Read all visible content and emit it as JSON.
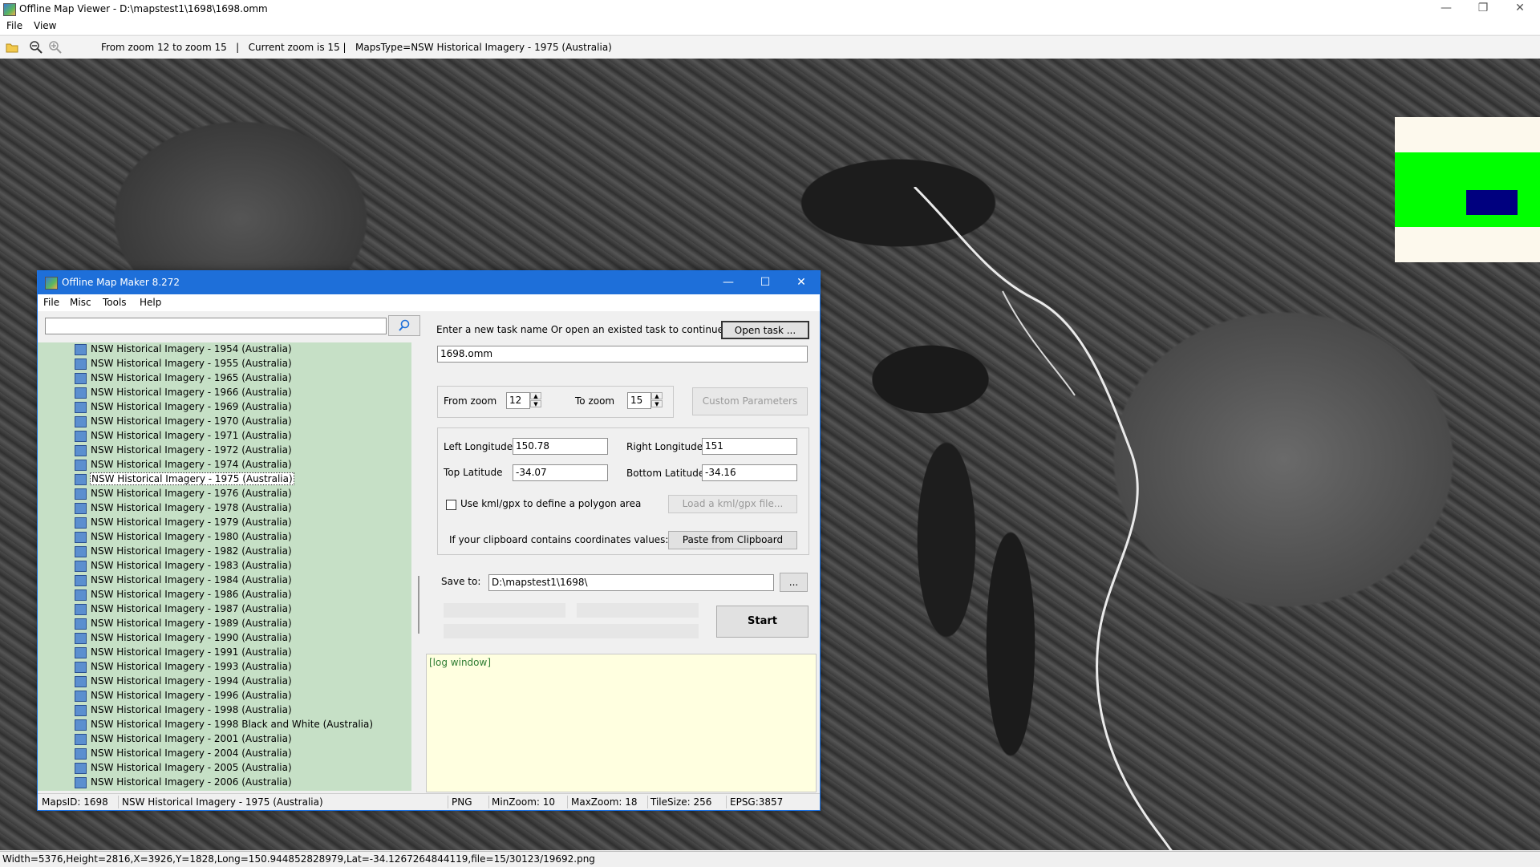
{
  "viewer": {
    "title": "Offline Map Viewer - D:\\mapstest1\\1698\\1698.omm",
    "window_controls": {
      "minimize": "—",
      "maximize": "❐",
      "close": "✕"
    },
    "menu": [
      "File",
      "View"
    ],
    "toolbar_status": "From zoom 12 to zoom 15   |   Current zoom is 15 |   MapsType=NSW Historical Imagery - 1975 (Australia)",
    "statusbar": "Width=5376,Height=2816,X=3926,Y=1828,Long=150.944852828979,Lat=-34.1267264844119,file=15/30123/19692.png",
    "minimap_colors": {
      "background": "#fdf9ed",
      "coverage": "#00ff00",
      "viewport": "#00007f"
    }
  },
  "dialog": {
    "title": "Offline Map Maker 8.272",
    "window_controls": {
      "minimize": "—",
      "maximize": "☐",
      "close": "✕"
    },
    "menu": [
      "File",
      "Misc",
      "Tools",
      "Help"
    ],
    "search": {
      "value": "",
      "icon": "search-icon"
    },
    "tree": {
      "items": [
        "NSW Historical Imagery - 1954 (Australia)",
        "NSW Historical Imagery - 1955 (Australia)",
        "NSW Historical Imagery - 1965 (Australia)",
        "NSW Historical Imagery - 1966 (Australia)",
        "NSW Historical Imagery - 1969 (Australia)",
        "NSW Historical Imagery - 1970 (Australia)",
        "NSW Historical Imagery - 1971 (Australia)",
        "NSW Historical Imagery - 1972 (Australia)",
        "NSW Historical Imagery - 1974 (Australia)",
        "NSW Historical Imagery - 1975 (Australia)",
        "NSW Historical Imagery - 1976 (Australia)",
        "NSW Historical Imagery - 1978 (Australia)",
        "NSW Historical Imagery - 1979 (Australia)",
        "NSW Historical Imagery - 1980 (Australia)",
        "NSW Historical Imagery - 1982 (Australia)",
        "NSW Historical Imagery - 1983 (Australia)",
        "NSW Historical Imagery - 1984 (Australia)",
        "NSW Historical Imagery - 1986 (Australia)",
        "NSW Historical Imagery - 1987 (Australia)",
        "NSW Historical Imagery - 1989 (Australia)",
        "NSW Historical Imagery - 1990 (Australia)",
        "NSW Historical Imagery - 1991 (Australia)",
        "NSW Historical Imagery - 1993 (Australia)",
        "NSW Historical Imagery - 1994 (Australia)",
        "NSW Historical Imagery - 1996 (Australia)",
        "NSW Historical Imagery - 1998 (Australia)",
        "NSW Historical Imagery - 1998 Black and White (Australia)",
        "NSW Historical Imagery - 2001 (Australia)",
        "NSW Historical Imagery - 2004 (Australia)",
        "NSW Historical Imagery - 2005 (Australia)",
        "NSW Historical Imagery - 2006 (Australia)"
      ],
      "selected": "NSW Historical Imagery - 1975 (Australia)",
      "background_color": "#c6e0c6"
    },
    "task": {
      "prompt": "Enter a new task name Or open an existed task to continue:",
      "open_button": "Open task ...",
      "name_value": "1698.omm"
    },
    "zoom": {
      "from_label": "From zoom",
      "from_value": "12",
      "to_label": "To zoom",
      "to_value": "15",
      "custom_button": "Custom Parameters"
    },
    "coords": {
      "left_lon_label": "Left Longitude",
      "left_lon_value": "150.78",
      "right_lon_label": "Right Longitude",
      "right_lon_value": "151",
      "top_lat_label": "Top Latitude",
      "top_lat_value": "-34.07",
      "bottom_lat_label": "Bottom Latitude",
      "bottom_lat_value": "-34.16",
      "kml_checkbox_label": "Use kml/gpx to define a polygon area",
      "kml_checked": false,
      "load_kml_button": "Load a kml/gpx file...",
      "clipboard_label": "If your clipboard contains coordinates values:",
      "paste_button": "Paste from Clipboard"
    },
    "save": {
      "label": "Save to:",
      "value": "D:\\mapstest1\\1698\\",
      "browse_button": "..."
    },
    "start_button": "Start",
    "log_text": "[log window]",
    "status": {
      "maps_id": "MapsID: 1698",
      "maps_name": "NSW Historical Imagery - 1975 (Australia)",
      "format": "PNG",
      "min_zoom": "MinZoom: 10",
      "max_zoom": "MaxZoom: 18",
      "tile_size": "TileSize: 256",
      "epsg": "EPSG:3857"
    }
  }
}
